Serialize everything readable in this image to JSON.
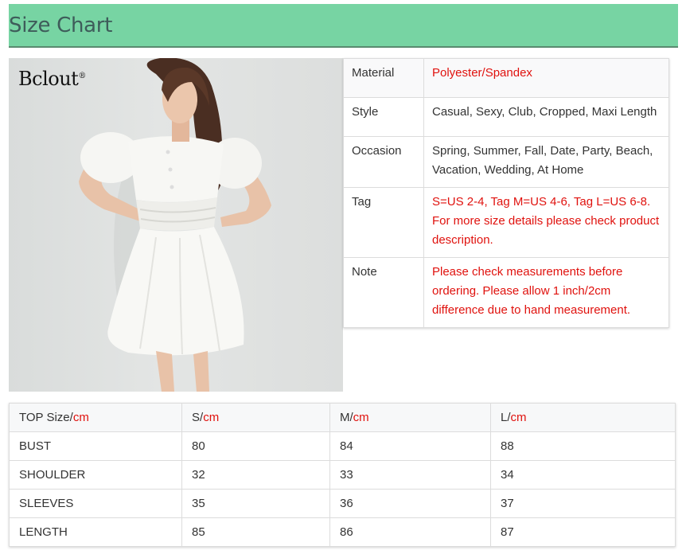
{
  "header": {
    "title": "Size Chart",
    "color": "#77d4a3"
  },
  "photo": {
    "brand": "Bclout",
    "brand_mark": "®"
  },
  "specs": [
    {
      "label": "Material",
      "value": "Polyester/Spandex",
      "highlight": true
    },
    {
      "label": "Style",
      "value": "Casual, Sexy, Club, Cropped, Maxi Length",
      "highlight": false
    },
    {
      "label": "Occasion",
      "value": "Spring, Summer, Fall, Date, Party, Beach, Vacation, Wedding, At Home",
      "highlight": false
    },
    {
      "label": "Tag",
      "value": "S=US 2-4, Tag M=US 4-6, Tag L=US 6-8. For more size details please check product description.",
      "highlight": true
    },
    {
      "label": "Note",
      "value": "Please check measurements before ordering. Please allow 1 inch/2cm difference due to hand measurement.",
      "highlight": true
    }
  ],
  "size_table": {
    "headers": [
      {
        "text": "TOP Size/",
        "unit": "cm"
      },
      {
        "text": "S/",
        "unit": "cm"
      },
      {
        "text": "M/",
        "unit": "cm"
      },
      {
        "text": "L/",
        "unit": "cm"
      }
    ],
    "rows": [
      [
        "BUST",
        "80",
        "84",
        "88"
      ],
      [
        "SHOULDER",
        "32",
        "33",
        "34"
      ],
      [
        "SLEEVES",
        "35",
        "36",
        "37"
      ],
      [
        "LENGTH",
        "85",
        "86",
        "87"
      ]
    ]
  },
  "colors": {
    "accent_red": "#e0120e",
    "header_text": "#3e5c5a"
  }
}
